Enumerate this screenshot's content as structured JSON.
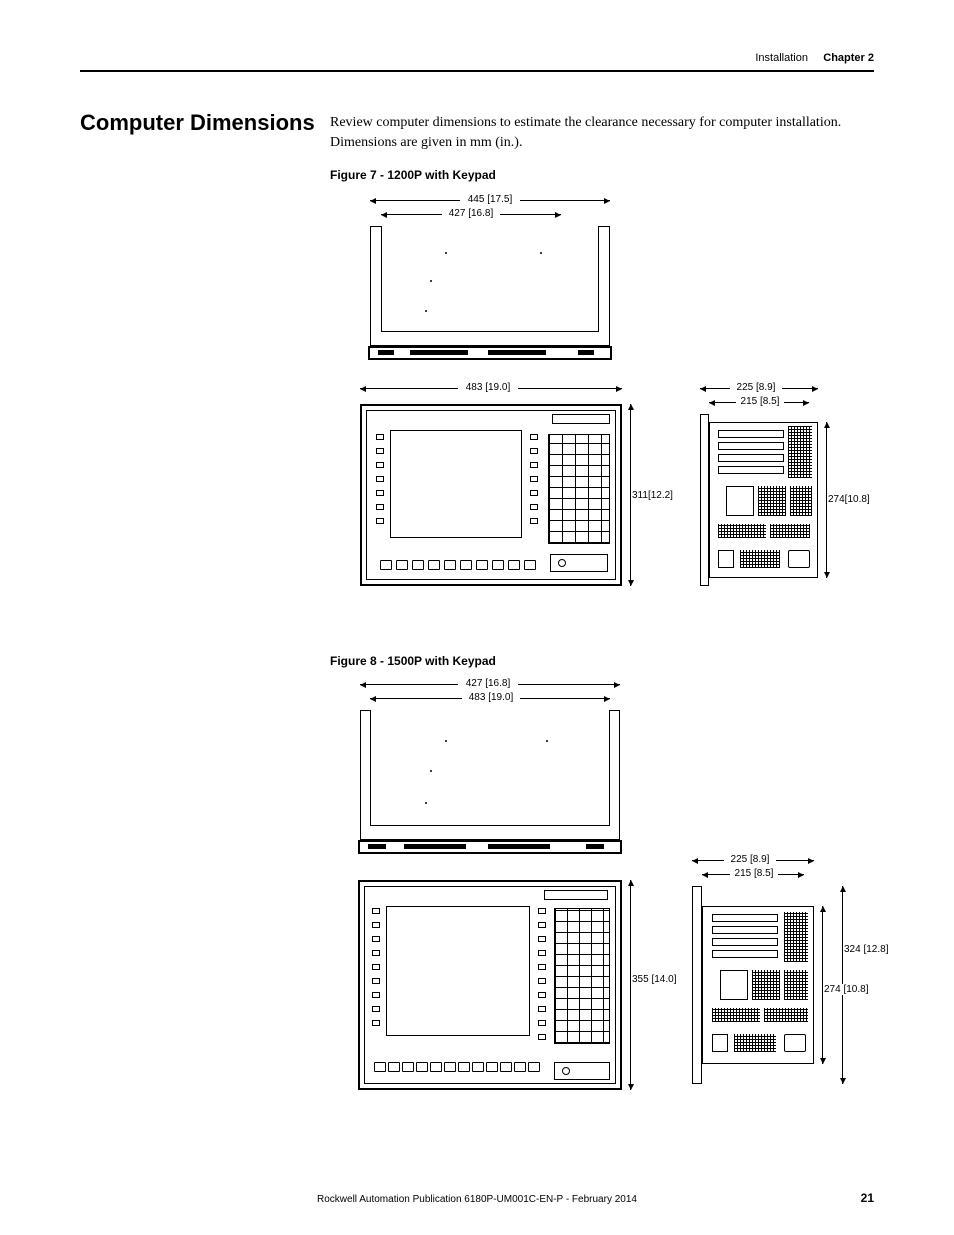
{
  "header": {
    "section": "Installation",
    "chapter_label": "Chapter 2"
  },
  "section_title": "Computer Dimensions",
  "intro": "Review computer dimensions to estimate the clearance necessary for computer installation. Dimensions are given in mm (in.).",
  "fig7": {
    "caption": "Figure 7 - 1200P with Keypad",
    "dims": {
      "w_top": "445 [17.5]",
      "w_bezel": "427 [16.8]",
      "w_front": "483 [19.0]",
      "h_front": "311[12.2]",
      "d_side_outer": "225 [8.9]",
      "d_side_inner": "215 [8.5]",
      "h_side": "274[10.8]"
    }
  },
  "fig8": {
    "caption": "Figure 8 - 1500P with Keypad",
    "dims": {
      "w_top": "427 [16.8]",
      "w_bezel": "483 [19.0]",
      "w_front": "",
      "h_front": "355 [14.0]",
      "d_side_outer": "225 [8.9]",
      "d_side_inner": "215 [8.5]",
      "h_side_outer": "324 [12.8]",
      "h_side_inner": "274 [10.8]"
    }
  },
  "footer": {
    "publication": "Rockwell Automation Publication 6180P-UM001C-EN-P - February 2014",
    "page": "21"
  }
}
